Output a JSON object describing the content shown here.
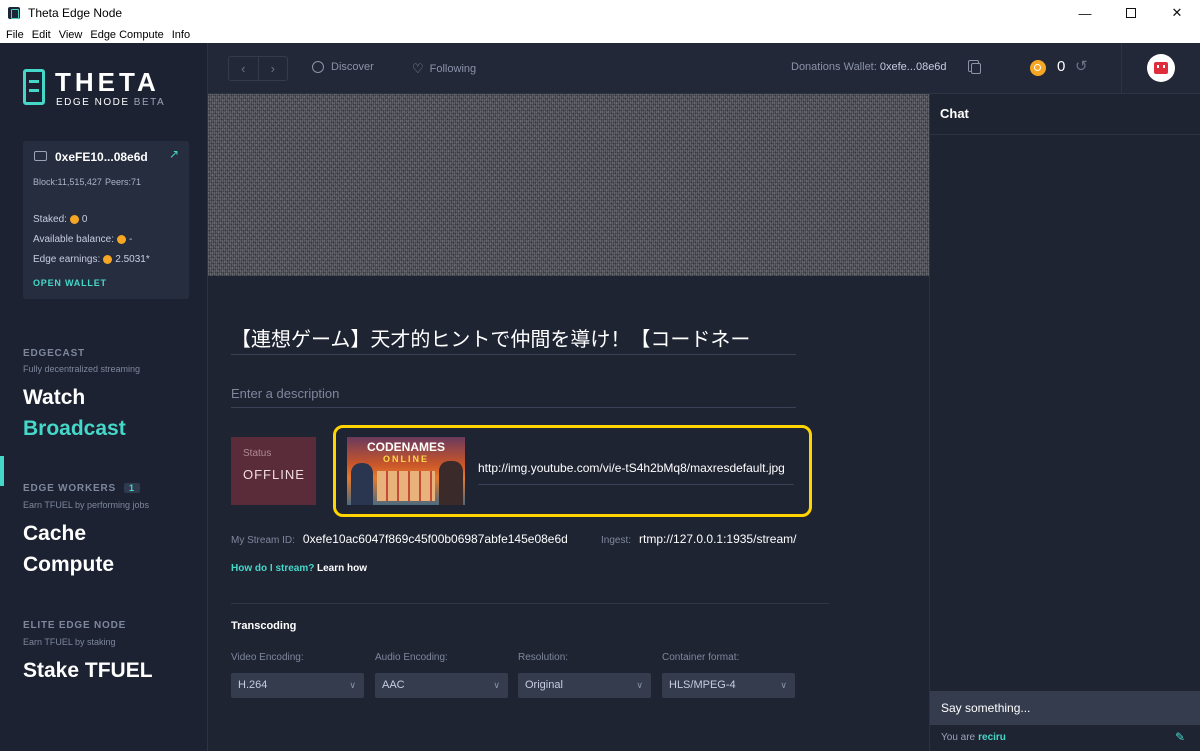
{
  "window": {
    "title": "Theta Edge Node",
    "minimize": "—",
    "close": "✕"
  },
  "menu": [
    "File",
    "Edit",
    "View",
    "Edge Compute",
    "Info"
  ],
  "logo": {
    "brand": "THETA",
    "subtitle": "EDGE NODE",
    "beta": "BETA"
  },
  "wallet": {
    "address": "0xeFE10...08e6d",
    "block": "Block:11,515,427",
    "peers": "Peers:71",
    "staked_label": "Staked:",
    "staked_value": "0",
    "available_label": "Available balance:",
    "available_value": "-",
    "earnings_label": "Edge earnings:",
    "earnings_value": "2.5031*",
    "open_wallet": "OPEN WALLET"
  },
  "sidebar": {
    "edgecast_label": "EDGECAST",
    "edgecast_sub": "Fully decentralized streaming",
    "watch": "Watch",
    "broadcast": "Broadcast",
    "workers_label": "EDGE WORKERS",
    "workers_badge": "1",
    "workers_sub": "Earn TFUEL by performing jobs",
    "cache": "Cache",
    "compute": "Compute",
    "elite_label": "ELITE EDGE NODE",
    "elite_sub": "Earn TFUEL by staking",
    "stake": "Stake TFUEL"
  },
  "topbar": {
    "back": "‹",
    "forward": "›",
    "discover": "Discover",
    "following": "Following",
    "donations_label": "Donations Wallet:",
    "donations_value": "0xefe...08e6d",
    "balance": "0",
    "refresh_icon": "↺"
  },
  "stream": {
    "title": "【連想ゲーム】天才的ヒントで仲間を導け！【コードネー",
    "description_placeholder": "Enter a description",
    "status_label": "Status",
    "status_value": "OFFLINE",
    "thumbnail_title": "CODENAMES",
    "thumbnail_sub": "ONLINE",
    "thumbnail_url": "http://img.youtube.com/vi/e-tS4h2bMq8/maxresdefault.jpg",
    "stream_id_label": "My Stream ID:",
    "stream_id": "0xefe10ac6047f869c45f00b06987abfe145e08e6d",
    "ingest_label": "Ingest:",
    "ingest": "rtmp://127.0.0.1:1935/stream/",
    "how_to": "How do I stream?",
    "learn_how": "Learn how"
  },
  "transcoding": {
    "heading": "Transcoding",
    "fields": [
      {
        "label": "Video Encoding:",
        "value": "H.264"
      },
      {
        "label": "Audio Encoding:",
        "value": "AAC"
      },
      {
        "label": "Resolution:",
        "value": "Original"
      },
      {
        "label": "Container format:",
        "value": "HLS/MPEG-4"
      }
    ]
  },
  "chat": {
    "title": "Chat",
    "input_placeholder": "Say something...",
    "you_are_label": "You are",
    "username": "reciru"
  },
  "colors": {
    "accent": "#45d8c9",
    "highlight": "#ffd400",
    "offline": "#5a2c3a",
    "coin": "#f5a623"
  }
}
